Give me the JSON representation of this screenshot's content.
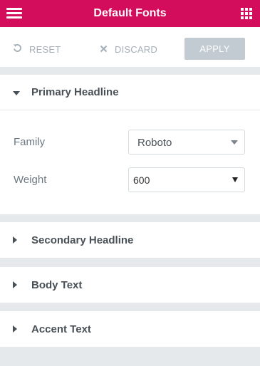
{
  "header": {
    "title": "Default Fonts",
    "menu_icon": "hamburger-icon",
    "apps_icon": "grid-icon"
  },
  "toolbar": {
    "reset_label": "RESET",
    "discard_label": "DISCARD",
    "apply_label": "APPLY"
  },
  "sections": {
    "primary": {
      "label": "Primary Headline",
      "expanded": true,
      "family_label": "Family",
      "family_value": "Roboto",
      "weight_label": "Weight",
      "weight_value": "600"
    },
    "secondary": {
      "label": "Secondary Headline"
    },
    "body": {
      "label": "Body Text"
    },
    "accent": {
      "label": "Accent Text"
    }
  },
  "colors": {
    "accent": "#d30c5c",
    "apply_disabled": "#c2cbd2",
    "background": "#e6e9ec"
  }
}
